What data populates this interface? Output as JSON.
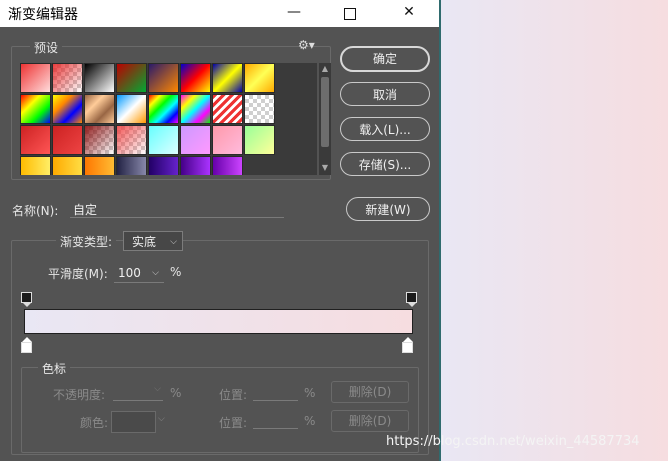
{
  "window": {
    "title": "渐变编辑器",
    "controls": {
      "minimize": "—",
      "maximize": "□",
      "close": "✕"
    }
  },
  "presets": {
    "label": "预设",
    "menu_icon": "gear-icon"
  },
  "buttons": {
    "ok": "确定",
    "cancel": "取消",
    "load": "载入(L)...",
    "save": "存储(S)...",
    "new": "新建(W)"
  },
  "name_field": {
    "label": "名称(N):",
    "value": "自定"
  },
  "gradient_type": {
    "label": "渐变类型:",
    "value": "实底"
  },
  "smoothness": {
    "label": "平滑度(M):",
    "value": "100",
    "unit": "%"
  },
  "gradient": {
    "start_color": "#e9e7f4",
    "end_color": "#f6dde0"
  },
  "color_stops": {
    "legend": "色标",
    "opacity_label": "不透明度:",
    "opacity_unit": "%",
    "position_label_1": "位置:",
    "position_unit_1": "%",
    "delete_1": "删除(D)",
    "color_label": "颜色:",
    "position_label_2": "位置:",
    "position_unit_2": "%",
    "delete_2": "删除(D)"
  },
  "watermark": "https://blog.csdn.net/weixin_44587734"
}
